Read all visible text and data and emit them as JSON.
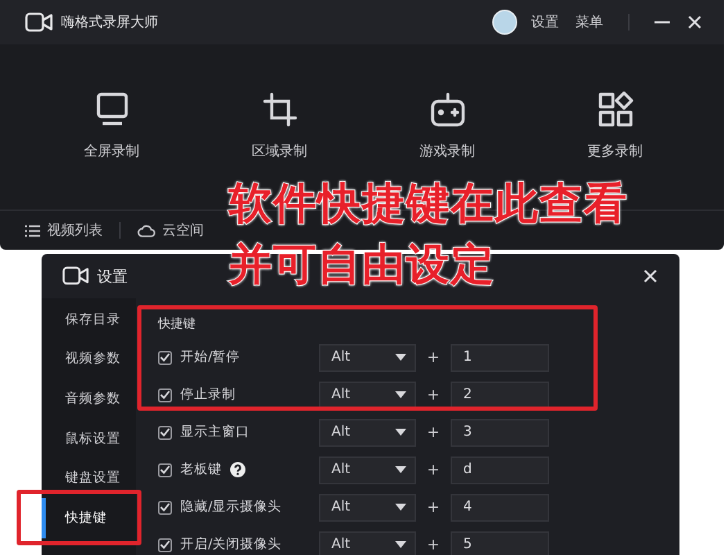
{
  "app": {
    "title": "嗨格式录屏大师",
    "header_links": [
      "设置",
      "菜单"
    ],
    "modes": [
      {
        "label": "全屏录制",
        "kind": "monitor"
      },
      {
        "label": "区域录制",
        "kind": "crop"
      },
      {
        "label": "游戏录制",
        "kind": "gamepad"
      },
      {
        "label": "更多录制",
        "kind": "grid"
      }
    ],
    "footer": [
      {
        "label": "视频列表",
        "kind": "list"
      },
      {
        "label": "云空间",
        "kind": "cloud"
      }
    ]
  },
  "annotation": {
    "lines": [
      "软件快捷键在此查看",
      "并可自由设定"
    ]
  },
  "settings": {
    "title": "设置",
    "sidebar": [
      {
        "label": "保存目录",
        "selected": false
      },
      {
        "label": "视频参数",
        "selected": false
      },
      {
        "label": "音频参数",
        "selected": false
      },
      {
        "label": "鼠标设置",
        "selected": false
      },
      {
        "label": "键盘设置",
        "selected": false
      },
      {
        "label": "快捷键",
        "selected": true
      }
    ],
    "section_title": "快捷键",
    "shortcuts": [
      {
        "label": "开始/暂停",
        "checked": true,
        "help": false,
        "modifier": "Alt",
        "joiner": "+",
        "key": "1"
      },
      {
        "label": "停止录制",
        "checked": true,
        "help": false,
        "modifier": "Alt",
        "joiner": "+",
        "key": "2"
      },
      {
        "label": "显示主窗口",
        "checked": true,
        "help": false,
        "modifier": "Alt",
        "joiner": "+",
        "key": "3"
      },
      {
        "label": "老板键",
        "checked": true,
        "help": true,
        "modifier": "Alt",
        "joiner": "+",
        "key": "d"
      },
      {
        "label": "隐藏/显示摄像头",
        "checked": true,
        "help": false,
        "modifier": "Alt",
        "joiner": "+",
        "key": "4"
      },
      {
        "label": "开启/关闭摄像头",
        "checked": true,
        "help": false,
        "modifier": "Alt",
        "joiner": "+",
        "key": "5"
      }
    ]
  }
}
